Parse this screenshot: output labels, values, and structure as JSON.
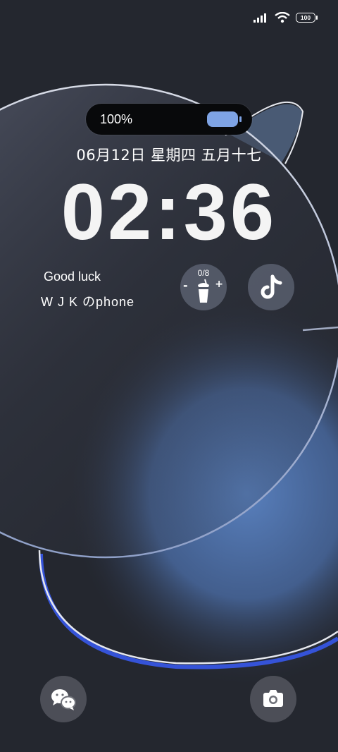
{
  "status_bar": {
    "battery_level": "100",
    "signal_icon": "signal-bars-icon",
    "wifi_icon": "wifi-icon"
  },
  "battery_capsule": {
    "percent_text": "100%",
    "fill_fraction": 1.0,
    "color": "#7ea3e4"
  },
  "lockscreen": {
    "date_text": "06月12日  星期四  五月十七",
    "time_text": "02:36",
    "greeting": "Good luck",
    "device_name": "W J K  のphone"
  },
  "water_widget": {
    "count_text": "0/8",
    "minus_label": "-",
    "plus_label": "+",
    "icon": "water-cup-icon"
  },
  "shortcuts": {
    "top_right_icon": "tiktok-icon",
    "bottom_left_icon": "wechat-icon",
    "bottom_right_icon": "camera-icon"
  },
  "colors": {
    "background": "#24272f",
    "accent_blue": "#5b84c4",
    "ring_blue": "#3553d8"
  }
}
